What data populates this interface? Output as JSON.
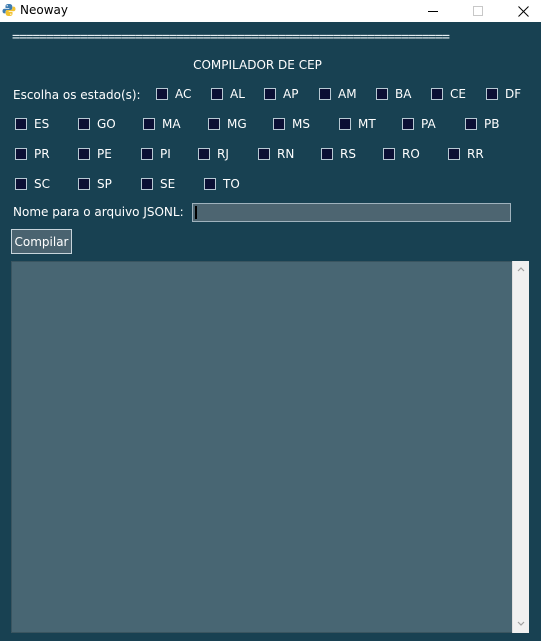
{
  "window": {
    "title": "Neoway"
  },
  "separator": "================================================================",
  "heading": "COMPILADOR DE CEP",
  "states_label": "Escolha os estado(s):",
  "states": {
    "row1": [
      "AC",
      "AL",
      "AP",
      "AM",
      "BA",
      "CE",
      "DF"
    ],
    "row2": [
      "ES",
      "GO",
      "MA",
      "MG",
      "MS",
      "MT",
      "PA",
      "PB"
    ],
    "row3": [
      "PR",
      "PE",
      "PI",
      "RJ",
      "RN",
      "RS",
      "RO",
      "RR"
    ],
    "row4": [
      "SC",
      "SP",
      "SE",
      "TO"
    ]
  },
  "filename": {
    "label": "Nome para o arquivo JSONL:",
    "value": ""
  },
  "compile_button": "Compilar",
  "colors": {
    "background": "#184152",
    "field": "#486673",
    "checkbox": "#0b0f34"
  },
  "icons": [
    "python-icon",
    "minimize-icon",
    "maximize-icon",
    "close-icon",
    "scroll-up-icon",
    "scroll-down-icon"
  ]
}
